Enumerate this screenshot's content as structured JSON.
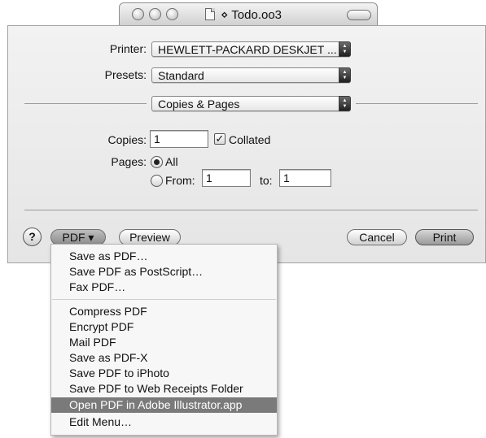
{
  "window": {
    "title": "⋄ Todo.oo3"
  },
  "printer": {
    "label": "Printer:",
    "value": "HEWLETT-PACKARD DESKJET ..."
  },
  "presets": {
    "label": "Presets:",
    "value": "Standard"
  },
  "pane": {
    "value": "Copies & Pages"
  },
  "copies": {
    "label": "Copies:",
    "value": "1",
    "collated_label": "Collated",
    "collated_checked": true
  },
  "pages": {
    "label": "Pages:",
    "all_label": "All",
    "from_label": "From:",
    "from_value": "1",
    "to_label": "to:",
    "to_value": "1",
    "selected": "All"
  },
  "buttons": {
    "help": "?",
    "pdf": "PDF ▾",
    "preview": "Preview",
    "cancel": "Cancel",
    "print": "Print"
  },
  "pdf_menu": {
    "group1": [
      "Save as PDF…",
      "Save PDF as PostScript…",
      "Fax PDF…"
    ],
    "group2": [
      "Compress PDF",
      "Encrypt PDF",
      "Mail PDF",
      "Save as PDF-X",
      "Save PDF to iPhoto",
      "Save PDF to Web Receipts Folder",
      "Open PDF in Adobe Illustrator.app",
      "Edit Menu…"
    ],
    "highlighted": "Open PDF in Adobe Illustrator.app"
  },
  "icons": {
    "window_controls": "traffic-light-icon",
    "document": "document-icon",
    "popup_arrows": "updown-arrows-icon",
    "checkmark": "checkmark-icon"
  },
  "colors": {
    "highlight": "#7a7a7a",
    "panel": "#ececec"
  }
}
